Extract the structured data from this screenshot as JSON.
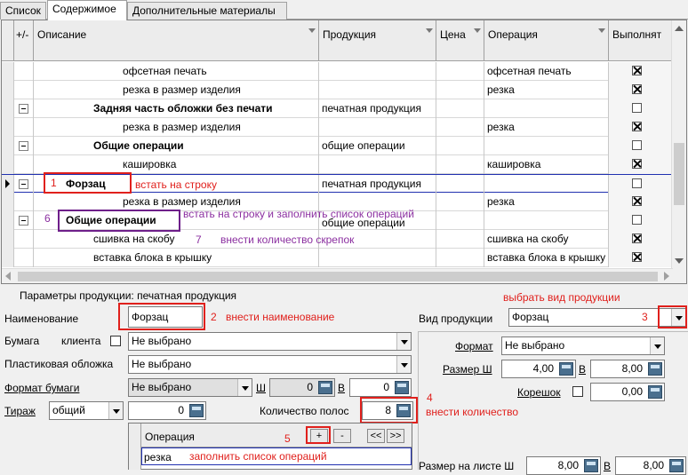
{
  "tabs": [
    "Список",
    "Содержимое",
    "Дополнительные материалы"
  ],
  "grid": {
    "headers": {
      "plusminus": "+/-",
      "desc": "Описание",
      "product": "Продукция",
      "price": "Цена",
      "operation": "Операция",
      "done": "Выполнят"
    },
    "rows": [
      {
        "desc": "офсетная печать",
        "product": "",
        "operation": "офсетная печать",
        "done": true,
        "bold": false,
        "toggle": false
      },
      {
        "desc": "резка в размер изделия",
        "product": "",
        "operation": "резка",
        "done": true,
        "bold": false,
        "toggle": false
      },
      {
        "desc": "Задняя часть обложки без печати",
        "product": "печатная продукция",
        "operation": "",
        "done": false,
        "bold": true,
        "toggle": true
      },
      {
        "desc": "резка в размер изделия",
        "product": "",
        "operation": "резка",
        "done": true,
        "bold": false,
        "toggle": false
      },
      {
        "desc": "Общие операции",
        "product": "общие операции",
        "operation": "",
        "done": false,
        "bold": true,
        "toggle": true
      },
      {
        "desc": "каширoвка",
        "product": "",
        "operation": "каширoвка",
        "done": true,
        "bold": false,
        "toggle": false
      },
      {
        "desc": "Форзац",
        "product": "печатная продукция",
        "operation": "",
        "done": false,
        "bold": true,
        "toggle": true
      },
      {
        "desc": "резка в размер изделия",
        "product": "",
        "operation": "резка",
        "done": true,
        "bold": false,
        "toggle": false
      },
      {
        "desc": "Общие операции",
        "product": "общие операции",
        "operation": "",
        "done": false,
        "bold": true,
        "toggle": true
      },
      {
        "desc": "сшивка на скобу",
        "product": "",
        "operation": "сшивка на скобу",
        "done": true,
        "bold": false,
        "toggle": false
      },
      {
        "desc": "вставка блока в крышку",
        "product": "",
        "operation": "вставка блока в крышку",
        "done": true,
        "bold": false,
        "toggle": false
      }
    ]
  },
  "annotations": {
    "a1": "1",
    "a1_text": "встать на строку",
    "a6": "6",
    "a6_text": "встать на строку и заполнить список операций",
    "a7": "7",
    "a7_text": "внести количество скрепок",
    "a2": "2",
    "a2_text": "внести наименование",
    "a3_text": "выбрать вид продукции",
    "a3": "3",
    "a4": "4",
    "a4_text": "внести количество",
    "a5": "5",
    "a5_text": "заполнить список операций"
  },
  "params": {
    "title": "Параметры продукции: печатная продукция",
    "name_label": "Наименование",
    "name_value": "Форзац",
    "paper_label": "Бумага",
    "client_label": "клиента",
    "paper_value": "Не выбрано",
    "cover_label": "Пластиковая обложка",
    "cover_value": "Не выбрано",
    "format_label": "Формат бумаги",
    "format_value": "Не выбрано",
    "w_label": "Ш",
    "w_value": "0",
    "h_label": "В",
    "h_value": "0",
    "run_label": "Тираж",
    "run_value": "общий",
    "run_num": "0",
    "strips_label": "Количество полос",
    "strips_value": "8",
    "ops_header": "Операция",
    "ops_plus": "+",
    "ops_minus": "-",
    "ops_prev": "<<",
    "ops_next": ">>",
    "ops_row": "резка",
    "kind_label": "Вид продукции",
    "kind_value": "Форзац",
    "fmt_label": "Формат",
    "fmt_value": "Не выбрано",
    "size_label": "Размер Ш",
    "size_w": "4,00",
    "size_h_label": "В",
    "size_h": "8,00",
    "spine_label": "Корешок",
    "spine_value": "0,00",
    "sheet_label": "Размер на листе Ш",
    "sheet_w": "8,00",
    "sheet_h_label": "В",
    "sheet_h": "8,00"
  }
}
